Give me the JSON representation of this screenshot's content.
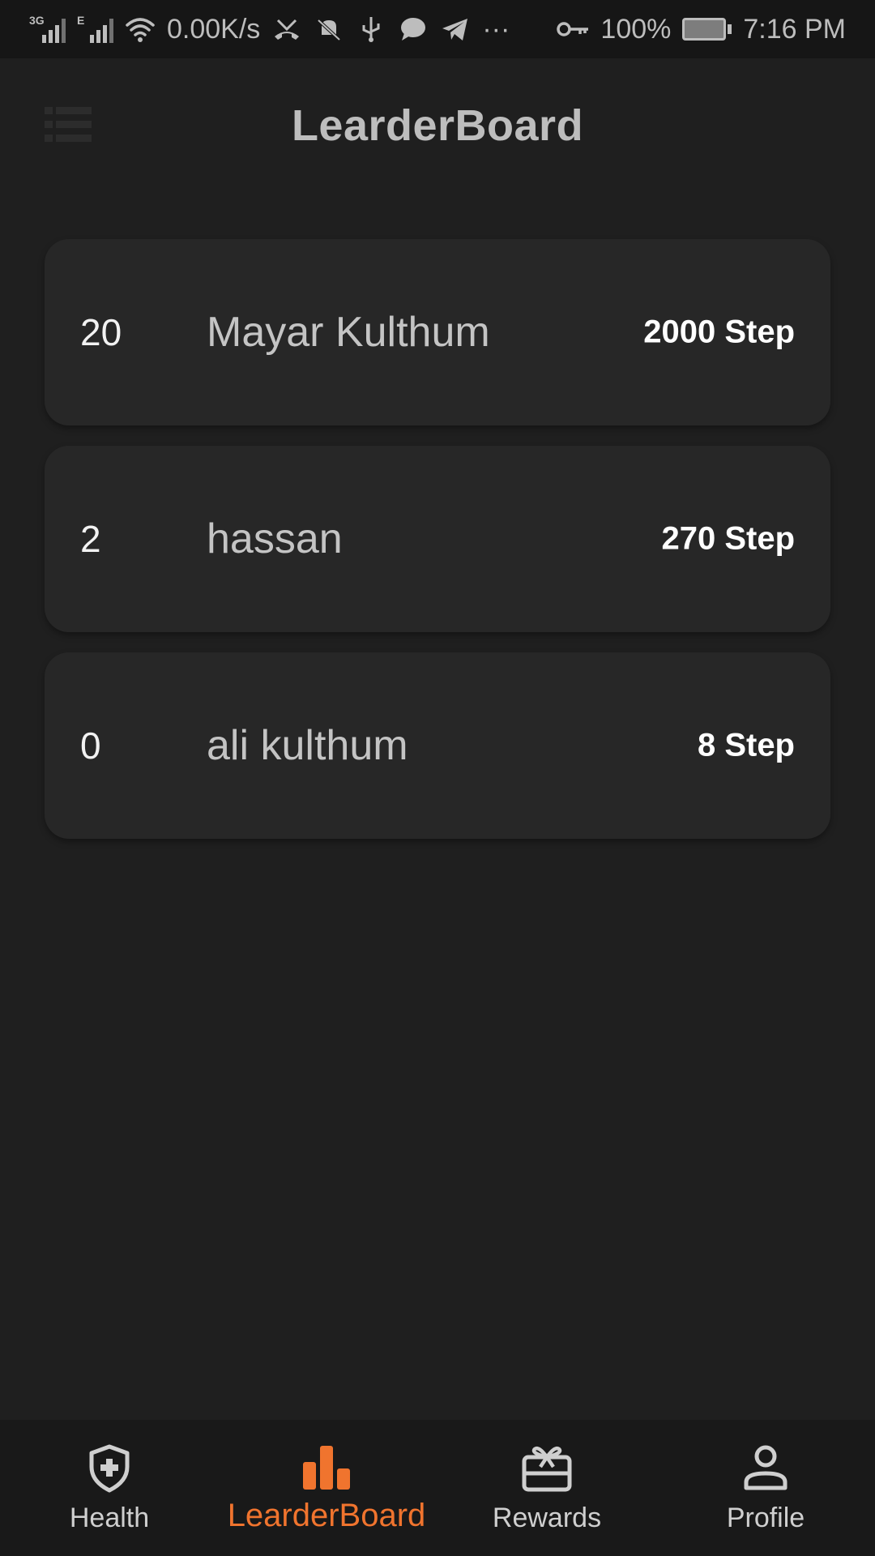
{
  "status_bar": {
    "net_3g": "3G",
    "net_e": "E",
    "speed": "0.00K/s",
    "more": "···",
    "battery_percent": "100%",
    "time": "7:16 PM"
  },
  "header": {
    "title": "LearderBoard"
  },
  "leaderboard": {
    "entries": [
      {
        "rank": "20",
        "name": "Mayar Kulthum",
        "steps": "2000 Step"
      },
      {
        "rank": "2",
        "name": "hassan",
        "steps": "270 Step"
      },
      {
        "rank": "0",
        "name": "ali kulthum",
        "steps": "8 Step"
      }
    ]
  },
  "bottom_nav": {
    "items": [
      {
        "label": "Health",
        "icon": "shield-plus-icon"
      },
      {
        "label": "LearderBoard",
        "icon": "bar-chart-icon"
      },
      {
        "label": "Rewards",
        "icon": "gift-card-icon"
      },
      {
        "label": "Profile",
        "icon": "person-icon"
      }
    ],
    "active_index": 1
  },
  "colors": {
    "background": "#1f1f1f",
    "card": "#272727",
    "accent": "#f0742e",
    "nav_background": "#191919"
  }
}
